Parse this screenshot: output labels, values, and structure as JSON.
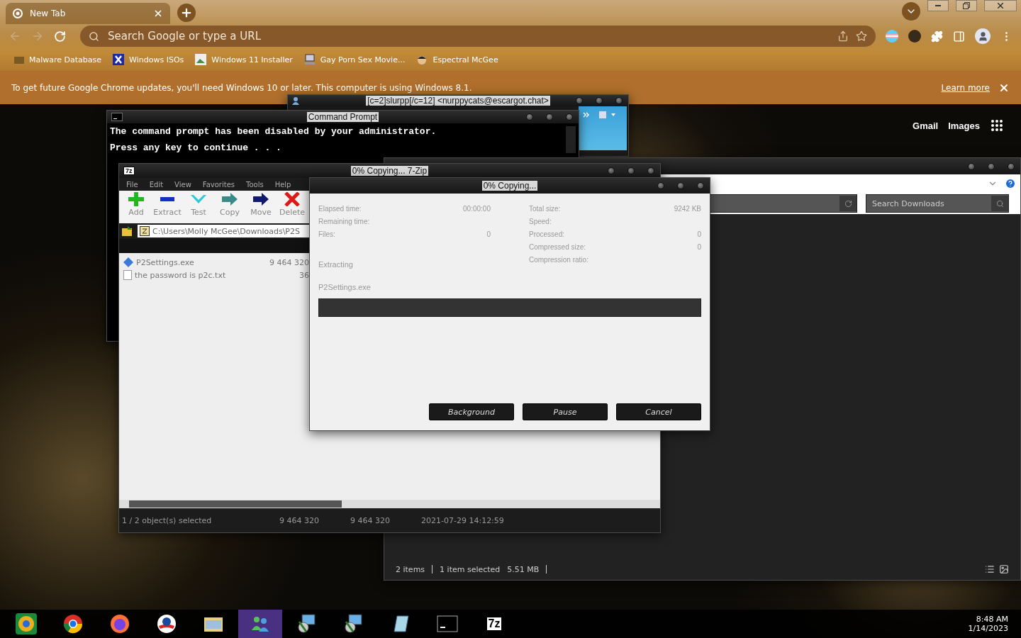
{
  "browser": {
    "tab": {
      "title": "New Tab"
    },
    "address": {
      "placeholder": "Search Google or type a URL"
    },
    "bookmarks": [
      {
        "label": "Malware Database",
        "kind": "folder"
      },
      {
        "label": "Windows ISOs",
        "kind": "x"
      },
      {
        "label": "Windows 11 Installer",
        "kind": "image"
      },
      {
        "label": "Gay Porn Sex Movie...",
        "kind": "computer"
      },
      {
        "label": "Espectral McGee",
        "kind": "face"
      }
    ],
    "infobar": {
      "message": "To get future Google Chrome updates, you'll need Windows 10 or later. This computer is using Windows 8.1.",
      "link": "Learn more"
    },
    "links": [
      "Gmail",
      "Images"
    ]
  },
  "windows": {
    "chat": {
      "title": "[c=2]slurpp[/c=12] <nurppycats@escargot.chat>"
    },
    "cmd": {
      "title": "Command Prompt",
      "lines": [
        "The command prompt has been disabled by your administrator.",
        "Press any key to continue . . ."
      ]
    },
    "explorer": {
      "search": {
        "placeholder": "Search Downloads"
      },
      "status": [
        "2 items",
        "1 item selected",
        "5.51 MB"
      ]
    },
    "sevenzip": {
      "icon_label": "7z",
      "title": "0% Copying... 7-Zip",
      "menu": [
        "File",
        "Edit",
        "View",
        "Favorites",
        "Tools",
        "Help"
      ],
      "toolbar": [
        {
          "label": "Add",
          "kind": "add"
        },
        {
          "label": "Extract",
          "kind": "extract"
        },
        {
          "label": "Test",
          "kind": "test"
        },
        {
          "label": "Copy",
          "kind": "copy"
        },
        {
          "label": "Move",
          "kind": "move"
        },
        {
          "label": "Delete",
          "kind": "delete"
        }
      ],
      "path": "C:\\Users\\Molly McGee\\Downloads\\P2S",
      "files": [
        {
          "name": "P2Settings.exe",
          "size": "9 464 320",
          "kind": "exe"
        },
        {
          "name": "the password is p2c.txt",
          "size": "36",
          "kind": "txt"
        }
      ],
      "status": [
        "1 / 2 object(s) selected",
        "9 464 320",
        "9 464 320",
        "2021-07-29 14:12:59"
      ]
    },
    "progress": {
      "title": "0% Copying...",
      "left": [
        {
          "label": "Elapsed time:",
          "value": "00:00:00"
        },
        {
          "label": "Remaining time:"
        },
        {
          "label": "Files:",
          "value": "0"
        }
      ],
      "right": [
        {
          "label": "Total size:",
          "value": "9242 KB"
        },
        {
          "label": "Speed:"
        },
        {
          "label": "Processed:",
          "value": "0"
        },
        {
          "label": "Compressed size:",
          "value": "0"
        },
        {
          "label": "Compression ratio:"
        }
      ],
      "action": "Extracting",
      "file": "P2Settings.exe",
      "level": 0,
      "buttons": [
        "Background",
        "Pause",
        "Cancel"
      ]
    }
  },
  "taskbar": {
    "apps": [
      {
        "kind": "chromium"
      },
      {
        "kind": "chrome"
      },
      {
        "kind": "firefox"
      },
      {
        "kind": "campaign"
      },
      {
        "kind": "folder"
      },
      {
        "kind": "people"
      },
      {
        "kind": "installer"
      },
      {
        "kind": "installer"
      },
      {
        "kind": "notepad"
      },
      {
        "kind": "terminal"
      },
      {
        "kind": "archive",
        "label": "7z"
      }
    ],
    "time": "8:48 AM",
    "date": "1/14/2023"
  }
}
